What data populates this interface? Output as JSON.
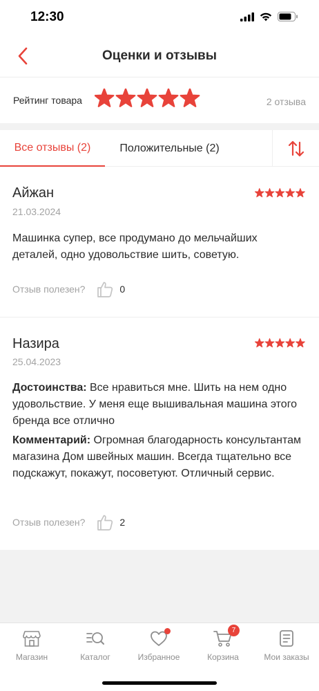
{
  "status_bar": {
    "time": "12:30"
  },
  "header": {
    "title": "Оценки и отзывы"
  },
  "rating": {
    "label": "Рейтинг товара",
    "stars": 5,
    "count": "2 отзыва"
  },
  "tabs": {
    "all": "Все отзывы (2)",
    "positive": "Положительные (2)"
  },
  "reviews": [
    {
      "author": "Айжан",
      "date": "21.03.2024",
      "stars": 5,
      "text": "Машинка супер, все продумано до мельчайших деталей, одно удовольствие шить, советую.",
      "helpful_label": "Отзыв полезен?",
      "likes": "0"
    },
    {
      "author": "Назира",
      "date": "25.04.2023",
      "stars": 5,
      "pros_label": "Достоинства:",
      "pros": " Все нравиться мне. Шить на нем одно удовольствие. У меня еще вышивальная машина этого бренда все отлично",
      "comment_label": "Комментарий:",
      "comment": " Огромная благодарность консультантам магазина Дом швейных машин. Всегда тщательно все подскажут, покажут, посоветуют. Отличный сервис.",
      "helpful_label": "Отзыв полезен?",
      "likes": "2"
    }
  ],
  "bottom_nav": {
    "items": [
      {
        "label": "Магазин",
        "icon": "store-icon"
      },
      {
        "label": "Каталог",
        "icon": "catalog-search-icon"
      },
      {
        "label": "Избранное",
        "icon": "heart-icon"
      },
      {
        "label": "Корзина",
        "icon": "cart-icon",
        "badge": "7"
      },
      {
        "label": "Мои заказы",
        "icon": "orders-icon"
      }
    ]
  },
  "colors": {
    "accent": "#e8433a",
    "muted": "#a3a3a3",
    "separator": "#f2f2f2"
  }
}
